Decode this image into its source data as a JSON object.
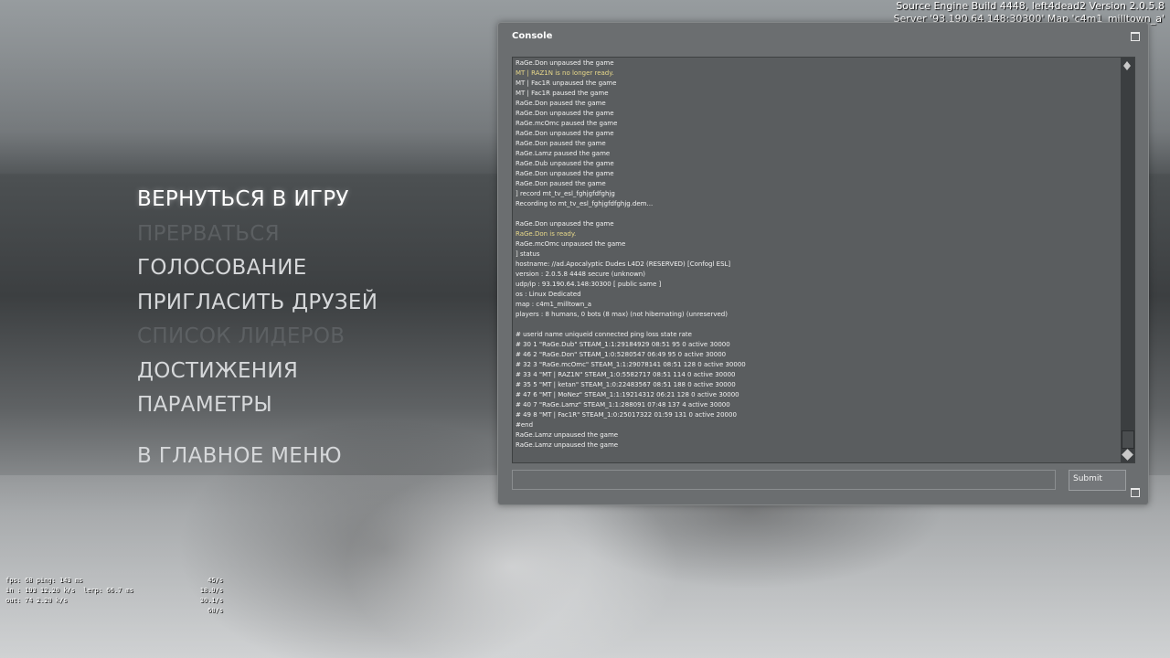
{
  "build_info": {
    "line1": "Source Engine Build 4448, left4dead2 Version 2.0.5.8",
    "line2": "Server '93.190.64.148:30300' Map 'c4m1_milltown_a'"
  },
  "main_menu": {
    "items": [
      {
        "label": "ВЕРНУТЬСЯ В ИГРУ",
        "state": "active"
      },
      {
        "label": "ПРЕРВАТЬСЯ",
        "state": "disabled"
      },
      {
        "label": "ГОЛОСОВАНИЕ",
        "state": "normal"
      },
      {
        "label": "ПРИГЛАСИТЬ ДРУЗЕЙ",
        "state": "normal"
      },
      {
        "label": "СПИСОК ЛИДЕРОВ",
        "state": "disabled"
      },
      {
        "label": "ДОСТИЖЕНИЯ",
        "state": "normal"
      },
      {
        "label": "ПАРАМЕТРЫ",
        "state": "normal"
      },
      {
        "label": "В ГЛАВНОЕ МЕНЮ",
        "state": "normal"
      }
    ]
  },
  "console": {
    "title": "Console",
    "submit_label": "Submit",
    "input_value": "",
    "log": [
      {
        "text": "RaGe.Don unpaused the game",
        "color": "white"
      },
      {
        "text": "MT | RAZ1N is no longer ready.",
        "color": "yellow"
      },
      {
        "text": "MT | Fac1R unpaused the game",
        "color": "white"
      },
      {
        "text": "MT | Fac1R paused the game",
        "color": "white"
      },
      {
        "text": "RaGe.Don paused the game",
        "color": "white"
      },
      {
        "text": "RaGe.Don unpaused the game",
        "color": "white"
      },
      {
        "text": "RaGe.mcOmc paused the game",
        "color": "white"
      },
      {
        "text": "RaGe.Don unpaused the game",
        "color": "white"
      },
      {
        "text": "RaGe.Don paused the game",
        "color": "white"
      },
      {
        "text": "RaGe.Lamz paused the game",
        "color": "white"
      },
      {
        "text": "RaGe.Dub unpaused the game",
        "color": "white"
      },
      {
        "text": "RaGe.Don unpaused the game",
        "color": "white"
      },
      {
        "text": "RaGe.Don paused the game",
        "color": "white"
      },
      {
        "text": "] record mt_tv_esl_fghjgfdfghjg",
        "color": "white"
      },
      {
        "text": "Recording to mt_tv_esl_fghjgfdfghjg.dem...",
        "color": "white"
      },
      {
        "text": "",
        "color": "white"
      },
      {
        "text": "RaGe.Don unpaused the game",
        "color": "white"
      },
      {
        "text": "RaGe.Don is ready.",
        "color": "yellow"
      },
      {
        "text": "RaGe.mcOmc unpaused the game",
        "color": "white"
      },
      {
        "text": "] status",
        "color": "white"
      },
      {
        "text": "hostname: //ad.Apocalyptic Dudes L4D2 (RESERVED) [Confogl ESL]",
        "color": "white"
      },
      {
        "text": "version : 2.0.5.8 4448 secure  (unknown)",
        "color": "white"
      },
      {
        "text": "udp/ip  : 93.190.64.148:30300  [ public same ]",
        "color": "white"
      },
      {
        "text": "os      : Linux Dedicated",
        "color": "white"
      },
      {
        "text": "map     : c4m1_milltown_a",
        "color": "white"
      },
      {
        "text": "players : 8 humans, 0 bots (8 max) (not hibernating) (unreserved)",
        "color": "white"
      },
      {
        "text": "",
        "color": "white"
      },
      {
        "text": "# userid name uniqueid connected ping loss state rate",
        "color": "white"
      },
      {
        "text": "# 30 1 \"RaGe.Dub\" STEAM_1:1:29184929 08:51 95 0 active 30000",
        "color": "white"
      },
      {
        "text": "# 46 2 \"RaGe.Don\" STEAM_1:0:5280547 06:49 95 0 active 30000",
        "color": "white"
      },
      {
        "text": "# 32 3 \"RaGe.mcOmc\" STEAM_1:1:29078141 08:51 128 0 active 30000",
        "color": "white"
      },
      {
        "text": "# 33 4 \"MT | RAZ1N\" STEAM_1:0:5582717 08:51 114 0 active 30000",
        "color": "white"
      },
      {
        "text": "# 35 5 \"MT | ketan\" STEAM_1:0:22483567 08:51 188 0 active 30000",
        "color": "white"
      },
      {
        "text": "# 47 6 \"MT | MoNez\" STEAM_1:1:19214312 06:21 128 0 active 30000",
        "color": "white"
      },
      {
        "text": "# 40 7 \"RaGe.Lamz\" STEAM_1:1:288091 07:48 137 4 active 30000",
        "color": "white"
      },
      {
        "text": "# 49 8 \"MT | Fac1R\" STEAM_1:0:25017322 01:59 131 0 active 20000",
        "color": "white"
      },
      {
        "text": "#end",
        "color": "white"
      },
      {
        "text": "RaGe.Lamz unpaused the game",
        "color": "white"
      },
      {
        "text": "RaGe.Lamz unpaused the game",
        "color": "white"
      }
    ]
  },
  "net_graph": {
    "rows": [
      {
        "left": "fps:  68   ping: 143 ms",
        "mid": "",
        "right": "45/s"
      },
      {
        "left": "in :  193   12.20 k/s",
        "mid": "lerp:  66.7 ms",
        "right": "18.9/s"
      },
      {
        "left": "out:  74    2.20 k/s",
        "mid": "",
        "right": "30.1/s"
      },
      {
        "left": "",
        "mid": "",
        "right": "60/s"
      }
    ]
  },
  "colors": {
    "log_yellow": "#e8d98a",
    "log_white": "#f2f2f2",
    "console_bg": "#6b6e70"
  }
}
